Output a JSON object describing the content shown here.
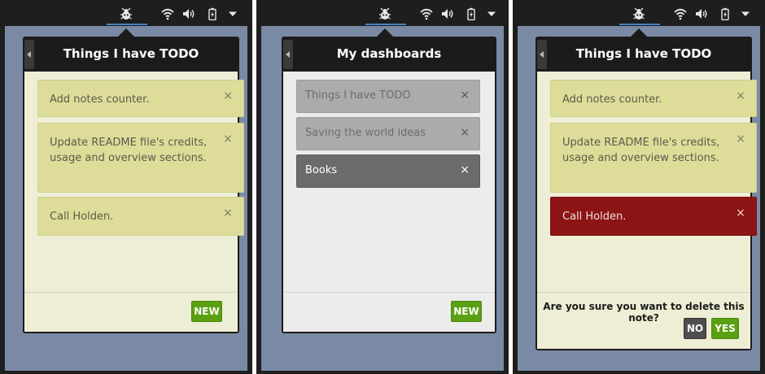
{
  "icons": {
    "app": "bug-indicator-icon",
    "wifi": "wifi-icon",
    "volume": "volume-icon",
    "battery": "battery-charging-icon",
    "menu": "system-menu-chevron-icon",
    "back": "back-arrow-icon",
    "close": "close-icon"
  },
  "colors": {
    "accent_line": "#4a7fc4",
    "note_yellow": "#dddd99",
    "note_delete_red": "#8c1414",
    "button_green": "#5aa012",
    "desktop": "#7a8aa4"
  },
  "panels": [
    {
      "title": "Things I have TODO",
      "notes": [
        {
          "text": "Add notes counter.",
          "close": "×"
        },
        {
          "text": "Update README file's credits, usage and overview sections.",
          "close": "×"
        },
        {
          "text": "Call Holden.",
          "close": "×"
        }
      ],
      "new_button": "NEW"
    },
    {
      "title": "My dashboards",
      "dashboards": [
        {
          "text": "Things I have TODO",
          "close": "×"
        },
        {
          "text": "Saving the world ideas",
          "close": "×"
        },
        {
          "text": "Books",
          "close": "×"
        }
      ],
      "new_button": "NEW"
    },
    {
      "title": "Things I have TODO",
      "notes": [
        {
          "text": "Add notes counter.",
          "close": "×"
        },
        {
          "text": "Update README file's credits, usage and overview sections.",
          "close": "×"
        },
        {
          "text": "Call Holden.",
          "close": "×"
        }
      ],
      "confirm_text": "Are you sure you want to delete this note?",
      "no_button": "NO",
      "yes_button": "YES"
    }
  ]
}
